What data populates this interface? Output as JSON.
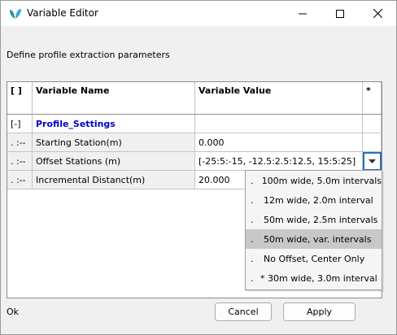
{
  "window": {
    "title": "Variable Editor",
    "icon": "leaf-app-icon"
  },
  "prompt": "Define profile extraction parameters",
  "grid": {
    "headers": {
      "col0": "[ ]",
      "col1": "Variable Name",
      "col2": "Variable Value",
      "col3": "*"
    },
    "rows": [
      {
        "marker": "[-]",
        "name": "Profile_Settings",
        "value": ""
      },
      {
        "marker": ". :--",
        "name": "Starting Station(m)",
        "value": "0.000"
      },
      {
        "marker": ". :--",
        "name": "Offset Stations (m)",
        "value": "[-25:5:-15, -12.5:2.5:12.5, 15:5:25]"
      },
      {
        "marker": ". :--",
        "name": "Incremental Distanct(m)",
        "value": "20.000"
      }
    ]
  },
  "dropdown": {
    "items": [
      {
        "dot": ".",
        "label": "100m wide, 5.0m intervals"
      },
      {
        "dot": ".",
        "label": "12m wide, 2.0m interval"
      },
      {
        "dot": ".",
        "label": "50m wide, 2.5m intervals"
      },
      {
        "dot": ".",
        "label": "50m wide, var. intervals"
      },
      {
        "dot": ".",
        "label": "No Offset, Center Only"
      },
      {
        "dot": ".",
        "label": "* 30m wide, 3.0m interval"
      }
    ],
    "selected_index": 3
  },
  "status": "Ok",
  "buttons": {
    "cancel": "Cancel",
    "apply": "Apply"
  },
  "colors": {
    "accent": "#2a6fbf",
    "group_text": "#0000cc",
    "selected_item": "#c8c8c8"
  }
}
